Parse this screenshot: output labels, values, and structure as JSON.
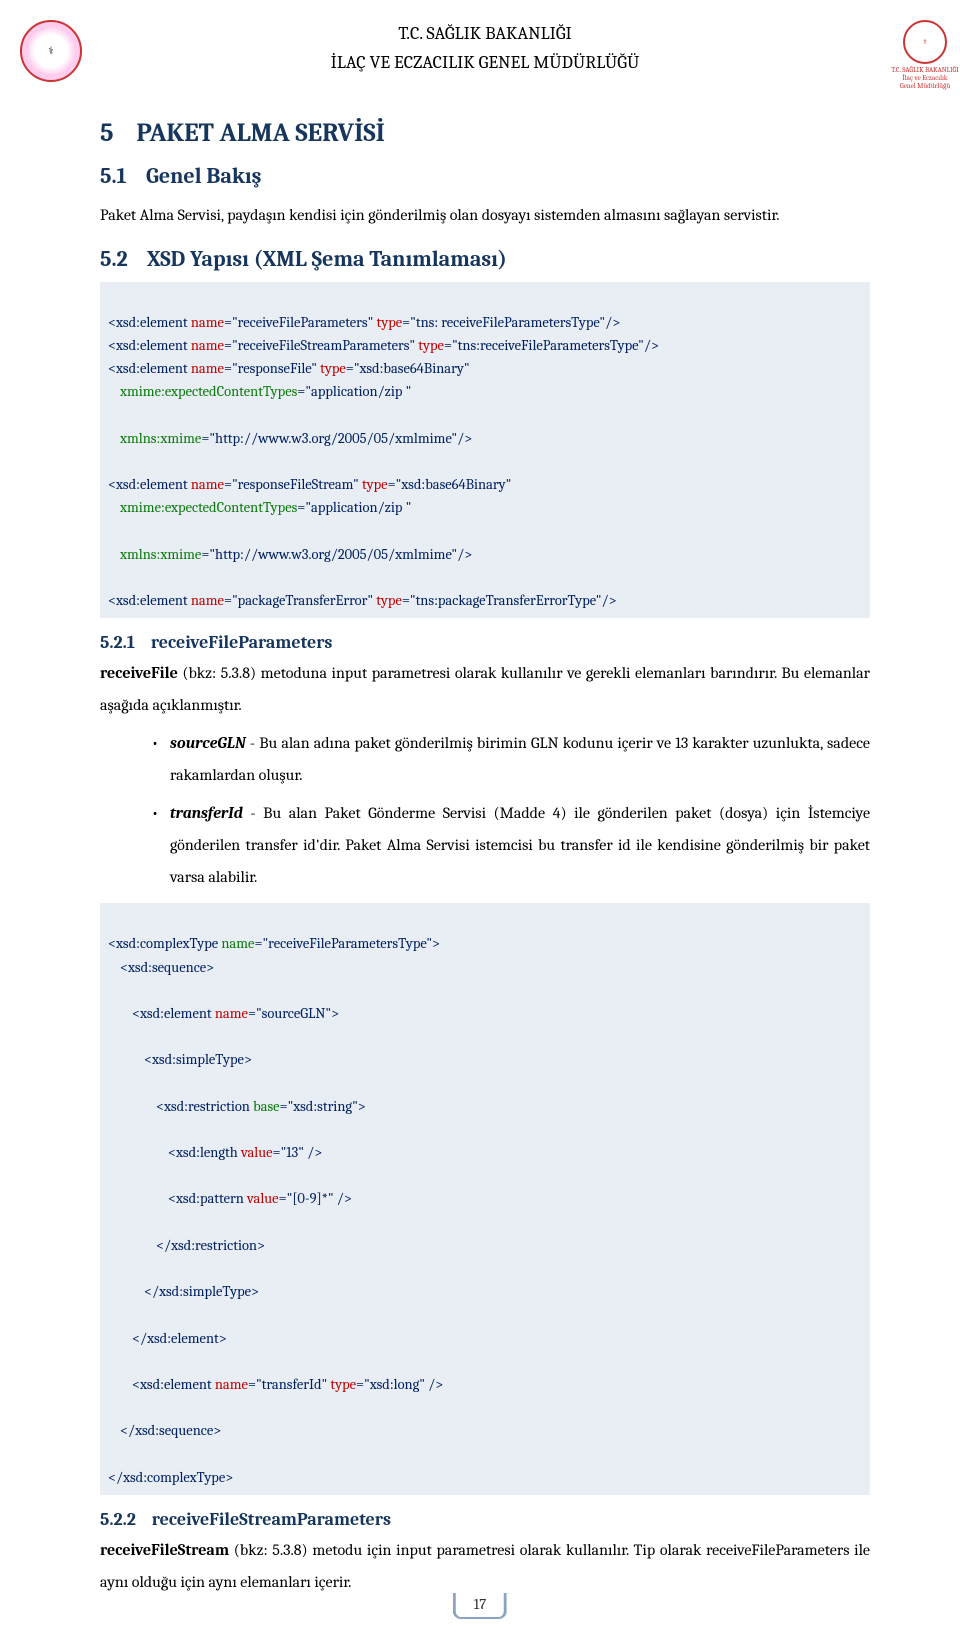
{
  "header": {
    "line1": "T.C. SAĞLIK BAKANLIĞI",
    "line2": "İLAÇ VE ECZACILIK GENEL MÜDÜRLÜĞÜ",
    "logoLeftAlt": "ministry-seal",
    "logoRightAlt": "pharmacy-directorate-seal",
    "logoRightLabel1": "T.C. SAĞLIK BAKANLIĞI",
    "logoRightLabel2": "İlaç ve Eczacılık",
    "logoRightLabel3": "Genel Müdürlüğü"
  },
  "section5": {
    "num": "5",
    "title": "PAKET ALMA SERVİSİ"
  },
  "section51": {
    "num": "5.1",
    "title": "Genel Bakış",
    "para": "Paket Alma Servisi, paydaşın kendisi için gönderilmiş olan dosyayı sistemden almasını sağlayan servistir."
  },
  "section52": {
    "num": "5.2",
    "title": "XSD Yapısı (XML Şema Tanımlaması)"
  },
  "code1": {
    "l1a": "<xsd:element ",
    "l1b": "name",
    "l1c": "=\"receiveFileParameters\" ",
    "l1d": "type",
    "l1e": "=\"tns: receiveFileParametersType\"/>",
    "l2a": "<xsd:element ",
    "l2b": "name",
    "l2c": "=\"receiveFileStreamParameters\" ",
    "l2d": "type",
    "l2e": "=\"tns:receiveFileParametersType\"/>",
    "l3a": "<xsd:element ",
    "l3b": "name",
    "l3c": "=\"responseFile\" ",
    "l3d": "type",
    "l3e": "=\"xsd:base64Binary\"",
    "l4a": "xmime:expectedContentTypes",
    "l4b": "=\"application/zip \"",
    "l5a": "xmlns:xmime",
    "l5b": "=\"http://www.w3.org/2005/05/xmlmime\"/>",
    "l6a": "<xsd:element ",
    "l6b": "name",
    "l6c": "=\"responseFileStream\" ",
    "l6d": "type",
    "l6e": "=\"xsd:base64Binary\"",
    "l7a": "xmime:expectedContentTypes",
    "l7b": "=\"application/zip \"",
    "l8a": "xmlns:xmime",
    "l8b": "=\"http://www.w3.org/2005/05/xmlmime\"/>",
    "l9a": "<xsd:element ",
    "l9b": "name",
    "l9c": "=\"packageTransferError\" ",
    "l9d": "type",
    "l9e": "=\"tns:packageTransferErrorType\"/>"
  },
  "section521": {
    "num": "5.2.1",
    "title": "receiveFileParameters",
    "para1a": "receiveFile",
    "para1b": " (bkz: 5.3.8) metoduna input parametresi olarak kullanılır ve gerekli elemanları barındırır. Bu elemanlar aşağıda açıklanmıştır.",
    "bullet1a": "sourceGLN",
    "bullet1b": " - Bu alan adına paket gönderilmiş birimin GLN kodunu içerir ve 13 karakter uzunlukta, sadece rakamlardan oluşur.",
    "bullet2a": "transferId",
    "bullet2b": " - Bu alan Paket Gönderme Servisi (Madde 4) ile gönderilen paket (dosya) için İstemciye gönderilen transfer id'dir. Paket Alma Servisi istemcisi bu transfer id ile kendisine gönderilmiş bir paket varsa alabilir."
  },
  "code2": {
    "l1a": "<xsd:complexType ",
    "l1b": "name",
    "l1c": "=\"receiveFileParametersType\">",
    "l2": "<xsd:sequence>",
    "l3a": "<xsd:element ",
    "l3b": "name",
    "l3c": "=\"sourceGLN\">",
    "l4": "<xsd:simpleType>",
    "l5a": "<xsd:restriction ",
    "l5b": "base",
    "l5c": "=\"xsd:string\">",
    "l6a": "<xsd:length ",
    "l6b": "value",
    "l6c": "=\"13\" />",
    "l7a": "<xsd:pattern ",
    "l7b": "value",
    "l7c": "=\"[0-9]*\" />",
    "l8": "</xsd:restriction>",
    "l9": "</xsd:simpleType>",
    "l10": "</xsd:element>",
    "l11a": "<xsd:element ",
    "l11b": "name",
    "l11c": "=\"transferId\" ",
    "l11d": "type",
    "l11e": "=\"xsd:long\" />",
    "l12": "</xsd:sequence>",
    "l13": "</xsd:complexType>"
  },
  "section522": {
    "num": "5.2.2",
    "title": "receiveFileStreamParameters",
    "para1a": "receiveFileStream",
    "para1b": " (bkz: 5.3.8) metodu için input parametresi olarak kullanılır. Tip olarak receiveFileParameters ile aynı olduğu için aynı elemanları içerir."
  },
  "pageNumber": "17"
}
